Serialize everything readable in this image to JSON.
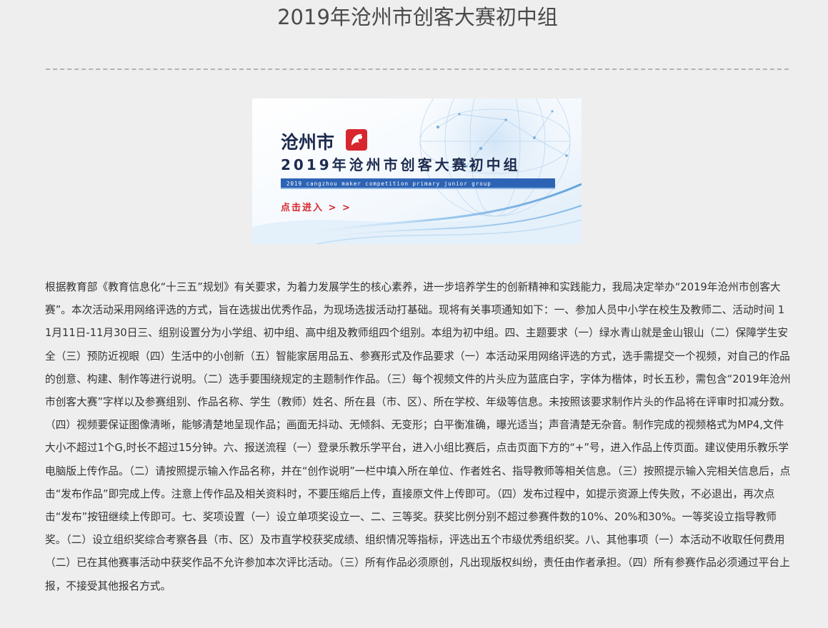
{
  "page": {
    "title": "2019年沧州市创客大赛初中组"
  },
  "banner": {
    "city": "沧州市",
    "heading": "2019年沧州市创客大赛初中组",
    "subheading": "2019 cangzhou maker competition primary junior group",
    "cta": "点击进入 > >",
    "colors": {
      "accent_red": "#d8262e",
      "heading_navy": "#1d2b4f",
      "strip_blue": "#2d63b4",
      "decor_blue": "#9cc6ea"
    }
  },
  "content": {
    "body": "根据教育部《教育信息化“十三五”规划》有关要求，为着力发展学生的核心素养，进一步培养学生的创新精神和实践能力，我局决定举办“2019年沧州市创客大赛”。本次活动采用网络评选的方式，旨在选拔出优秀作品，为现场选拔活动打基础。现将有关事项通知如下：一、参加人员中小学在校生及教师二、活动时间 11月11日-11月30日三、组别设置分为小学组、初中组、高中组及教师组四个组别。本组为初中组。四、主题要求（一）绿水青山就是金山银山（二）保障学生安全（三）预防近视眼（四）生活中的小创新（五）智能家居用品五、参赛形式及作品要求（一）本活动采用网络评选的方式，选手需提交一个视频，对自己的作品的创意、构建、制作等进行说明。（二）选手要围绕规定的主题制作作品。（三）每个视频文件的片头应为蓝底白字，字体为楷体，时长五秒，需包含“2019年沧州市创客大赛”字样以及参赛组别、作品名称、学生（教师）姓名、所在县（市、区）、所在学校、年级等信息。未按照该要求制作片头的作品将在评审时扣减分数。（四）视频要保证图像清晰，能够清楚地呈现作品；画面无抖动、无倾斜、无变形；白平衡准确，曝光适当；声音清楚无杂音。制作完成的视频格式为MP4,文件大小不超过1个G,时长不超过15分钟。六、报送流程（一）登录乐教乐学平台，进入小组比赛后，点击页面下方的“+”号，进入作品上传页面。建议使用乐教乐学电脑版上传作品。（二）请按照提示输入作品名称，并在“创作说明”一栏中填入所在单位、作者姓名、指导教师等相关信息。（三）按照提示输入完相关信息后，点击“发布作品”即完成上传。注意上传作品及相关资料时，不要压缩后上传，直接原文件上传即可。（四）发布过程中，如提示资源上传失败，不必退出，再次点击“发布”按钮继续上传即可。七、奖项设置（一）设立单项奖设立一、二、三等奖。获奖比例分别不超过参赛件数的10%、20%和30%。一等奖设立指导教师奖。（二）设立组织奖综合考察各县（市、区）及市直学校获奖成绩、组织情况等指标，评选出五个市级优秀组织奖。八、其他事项（一）本活动不收取任何费用（二）已在其他赛事活动中获奖作品不允许参加本次评比活动。（三）所有作品必须原创，凡出现版权纠纷，责任由作者承担。（四）所有参赛作品必须通过平台上报，不接受其他报名方式。"
  }
}
